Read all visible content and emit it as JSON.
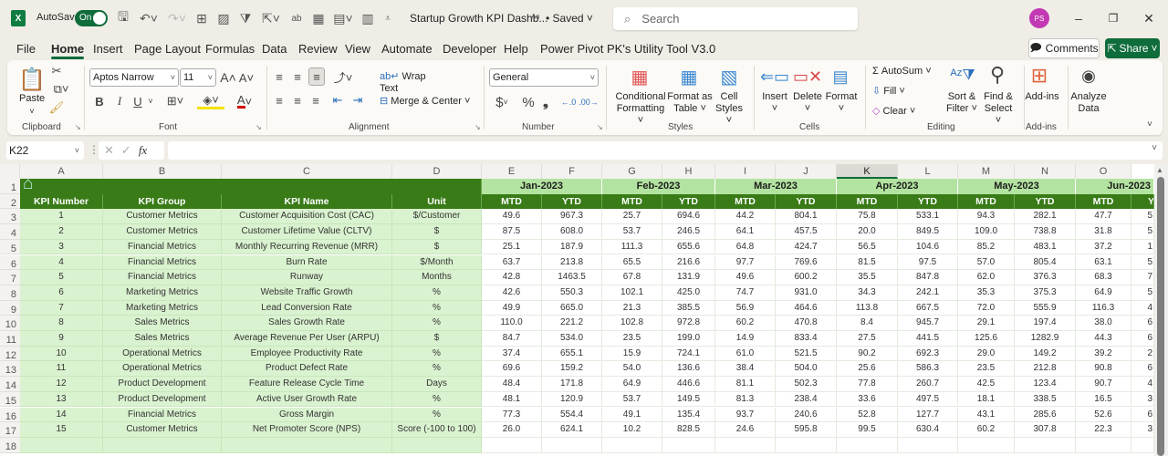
{
  "titlebar": {
    "app_icon": "excel-icon",
    "autosave_label": "AutoSave",
    "autosave_state": "On",
    "doc_title": "Startup Growth KPI Dashb...",
    "saved_status": "• Saved",
    "search_placeholder": "Search",
    "avatar_initials": "PS",
    "minimize": "–",
    "restore": "❐",
    "close": "✕"
  },
  "menu": {
    "tabs": [
      "File",
      "Home",
      "Insert",
      "Page Layout",
      "Formulas",
      "Data",
      "Review",
      "View",
      "Automate",
      "Developer",
      "Help",
      "Power Pivot",
      "PK's Utility Tool V3.0"
    ],
    "active": "Home",
    "comments_label": "Comments",
    "share_label": "Share"
  },
  "ribbon": {
    "clipboard": {
      "label": "Clipboard",
      "paste": "Paste"
    },
    "font": {
      "label": "Font",
      "font_name": "Aptos Narrow",
      "font_size": "11",
      "bold": "B",
      "italic": "I",
      "underline": "U"
    },
    "alignment": {
      "label": "Alignment",
      "wrap_text": "Wrap Text",
      "merge_center": "Merge & Center"
    },
    "number": {
      "label": "Number",
      "format": "General",
      "currency": "$",
      "percent": "%",
      "comma": "❟"
    },
    "styles": {
      "label": "Styles",
      "conditional_formatting": [
        "Conditional",
        "Formatting ˅"
      ],
      "format_as_table": [
        "Format as",
        "Table ˅"
      ],
      "cell_styles": [
        "Cell",
        "Styles ˅"
      ]
    },
    "cells": {
      "label": "Cells",
      "insert": "Insert",
      "delete": "Delete",
      "format": "Format"
    },
    "editing": {
      "label": "Editing",
      "autosum": "AutoSum",
      "fill": "Fill ˅",
      "clear": "Clear ˅",
      "sort_filter": [
        "Sort &",
        "Filter ˅"
      ],
      "find_select": [
        "Find &",
        "Select ˅"
      ]
    },
    "addins": {
      "label": "Add-ins",
      "addins_btn": "Add-ins"
    },
    "analyze": {
      "analyze_btn": [
        "Analyze",
        "Data"
      ]
    }
  },
  "formula_bar": {
    "name_box": "K22",
    "formula": ""
  },
  "sheet": {
    "columns": [
      "A",
      "B",
      "C",
      "D",
      "E",
      "F",
      "G",
      "H",
      "I",
      "J",
      "K",
      "L",
      "M",
      "N",
      "O"
    ],
    "selected_column": "K",
    "rows": [
      "1",
      "2",
      "3",
      "4",
      "5",
      "6",
      "7",
      "8",
      "9",
      "10",
      "11",
      "12",
      "13",
      "14",
      "15",
      "16",
      "17",
      "18"
    ],
    "home_icon": "home-icon",
    "headers": [
      "KPI Number",
      "KPI Group",
      "KPI Name",
      "Unit"
    ],
    "months": [
      "Jan-2023",
      "Feb-2023",
      "Mar-2023",
      "Apr-2023",
      "May-2023",
      "Jun-2023"
    ],
    "sub_headers": [
      "MTD",
      "YTD"
    ],
    "kpis": [
      {
        "num": "1",
        "group": "Customer Metrics",
        "name": "Customer Acquisition Cost (CAC)",
        "unit": "$/Customer",
        "values": [
          "49.6",
          "967.3",
          "25.7",
          "694.6",
          "44.2",
          "804.1",
          "75.8",
          "533.1",
          "94.3",
          "282.1",
          "47.7",
          "5"
        ]
      },
      {
        "num": "2",
        "group": "Customer Metrics",
        "name": "Customer Lifetime Value (CLTV)",
        "unit": "$",
        "values": [
          "87.5",
          "608.0",
          "53.7",
          "246.5",
          "64.1",
          "457.5",
          "20.0",
          "849.5",
          "109.0",
          "738.8",
          "31.8",
          "5"
        ]
      },
      {
        "num": "3",
        "group": "Financial Metrics",
        "name": "Monthly Recurring Revenue (MRR)",
        "unit": "$",
        "values": [
          "25.1",
          "187.9",
          "111.3",
          "655.6",
          "64.8",
          "424.7",
          "56.5",
          "104.6",
          "85.2",
          "483.1",
          "37.2",
          "1"
        ]
      },
      {
        "num": "4",
        "group": "Financial Metrics",
        "name": "Burn Rate",
        "unit": "$/Month",
        "values": [
          "63.7",
          "213.8",
          "65.5",
          "216.6",
          "97.7",
          "769.6",
          "81.5",
          "97.5",
          "57.0",
          "805.4",
          "63.1",
          "5"
        ]
      },
      {
        "num": "5",
        "group": "Financial Metrics",
        "name": "Runway",
        "unit": "Months",
        "values": [
          "42.8",
          "1463.5",
          "67.8",
          "131.9",
          "49.6",
          "600.2",
          "35.5",
          "847.8",
          "62.0",
          "376.3",
          "68.3",
          "7"
        ]
      },
      {
        "num": "6",
        "group": "Marketing Metrics",
        "name": "Website Traffic Growth",
        "unit": "%",
        "values": [
          "42.6",
          "550.3",
          "102.1",
          "425.0",
          "74.7",
          "931.0",
          "34.3",
          "242.1",
          "35.3",
          "375.3",
          "64.9",
          "5"
        ]
      },
      {
        "num": "7",
        "group": "Marketing Metrics",
        "name": "Lead Conversion Rate",
        "unit": "%",
        "values": [
          "49.9",
          "665.0",
          "21.3",
          "385.5",
          "56.9",
          "464.6",
          "113.8",
          "667.5",
          "72.0",
          "555.9",
          "116.3",
          "4"
        ]
      },
      {
        "num": "8",
        "group": "Sales Metrics",
        "name": "Sales Growth Rate",
        "unit": "%",
        "values": [
          "110.0",
          "221.2",
          "102.8",
          "972.8",
          "60.2",
          "470.8",
          "8.4",
          "945.7",
          "29.1",
          "197.4",
          "38.0",
          "6"
        ]
      },
      {
        "num": "9",
        "group": "Sales Metrics",
        "name": "Average Revenue Per User (ARPU)",
        "unit": "$",
        "values": [
          "84.7",
          "534.0",
          "23.5",
          "199.0",
          "14.9",
          "833.4",
          "27.5",
          "441.5",
          "125.6",
          "1282.9",
          "44.3",
          "6"
        ]
      },
      {
        "num": "10",
        "group": "Operational Metrics",
        "name": "Employee Productivity Rate",
        "unit": "%",
        "values": [
          "37.4",
          "655.1",
          "15.9",
          "724.1",
          "61.0",
          "521.5",
          "90.2",
          "692.3",
          "29.0",
          "149.2",
          "39.2",
          "2"
        ]
      },
      {
        "num": "11",
        "group": "Operational Metrics",
        "name": "Product Defect Rate",
        "unit": "%",
        "values": [
          "69.6",
          "159.2",
          "54.0",
          "136.6",
          "38.4",
          "504.0",
          "25.6",
          "586.3",
          "23.5",
          "212.8",
          "90.8",
          "6"
        ]
      },
      {
        "num": "12",
        "group": "Product Development",
        "name": "Feature Release Cycle Time",
        "unit": "Days",
        "values": [
          "48.4",
          "171.8",
          "64.9",
          "446.6",
          "81.1",
          "502.3",
          "77.8",
          "260.7",
          "42.5",
          "123.4",
          "90.7",
          "4"
        ]
      },
      {
        "num": "13",
        "group": "Product Development",
        "name": "Active User Growth Rate",
        "unit": "%",
        "values": [
          "48.1",
          "120.9",
          "53.7",
          "149.5",
          "81.3",
          "238.4",
          "33.6",
          "497.5",
          "18.1",
          "338.5",
          "16.5",
          "3"
        ]
      },
      {
        "num": "14",
        "group": "Financial Metrics",
        "name": "Gross Margin",
        "unit": "%",
        "values": [
          "77.3",
          "554.4",
          "49.1",
          "135.4",
          "93.7",
          "240.6",
          "52.8",
          "127.7",
          "43.1",
          "285.6",
          "52.6",
          "6"
        ]
      },
      {
        "num": "15",
        "group": "Customer Metrics",
        "name": "Net Promoter Score (NPS)",
        "unit": "Score (-100 to 100)",
        "values": [
          "26.0",
          "624.1",
          "10.2",
          "828.5",
          "24.6",
          "595.8",
          "99.5",
          "630.4",
          "60.2",
          "307.8",
          "22.3",
          "3"
        ]
      }
    ]
  },
  "colors": {
    "brand_green": "#0f6c3b",
    "header_dark_green": "#387b17",
    "header_light_green": "#b3e3a0",
    "body_light_green": "#d9f2cf",
    "avatar": "#c239b3"
  }
}
